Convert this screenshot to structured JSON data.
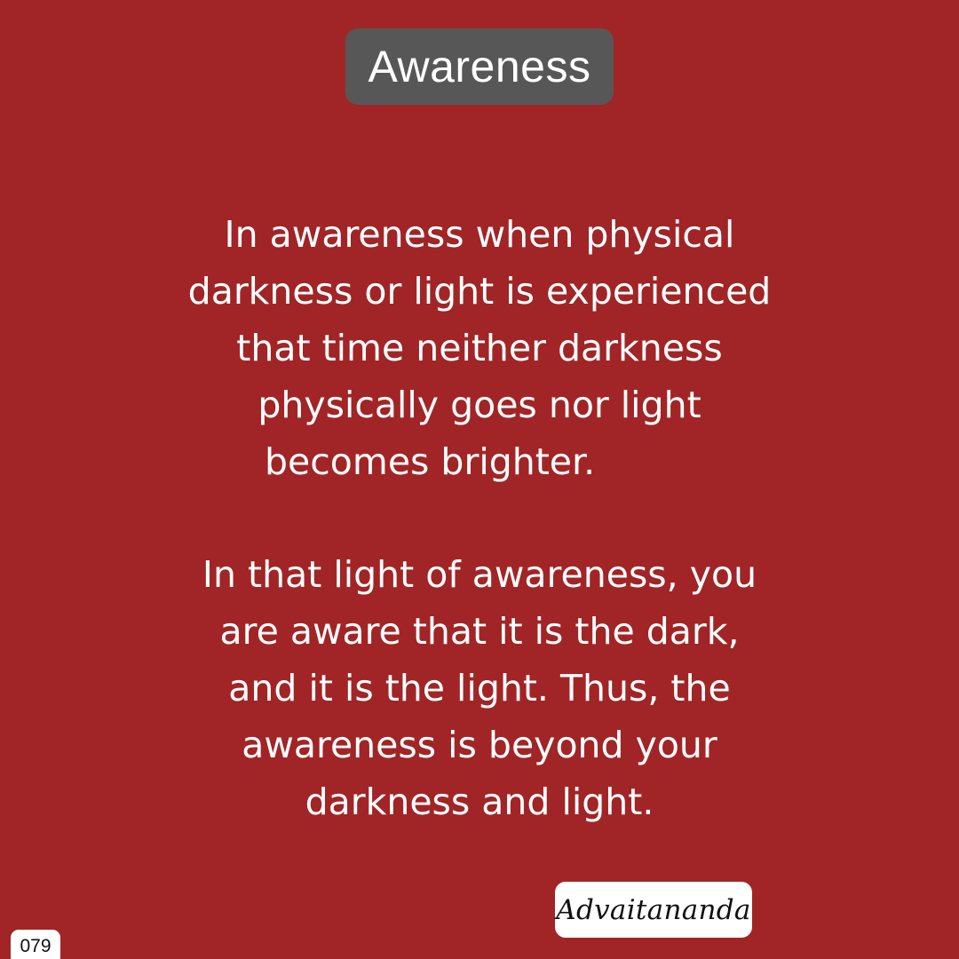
{
  "title": "Awareness",
  "paragraphs": [
    {
      "lines": [
        "In awareness when physical",
        "darkness or light is experienced",
        "that time neither darkness",
        "physically goes nor light",
        "becomes brighter."
      ]
    },
    {
      "lines": [
        "In that light of awareness, you",
        "are aware that it is the dark,",
        "and it is the light. Thus, the",
        "awareness is beyond your",
        "darkness and light."
      ]
    }
  ],
  "signature": "Advaitananda",
  "page_number": "079",
  "colors": {
    "background": "#a12526",
    "title_pill": "#575757",
    "text": "#ffffff",
    "signature_box": "#ffffff"
  }
}
